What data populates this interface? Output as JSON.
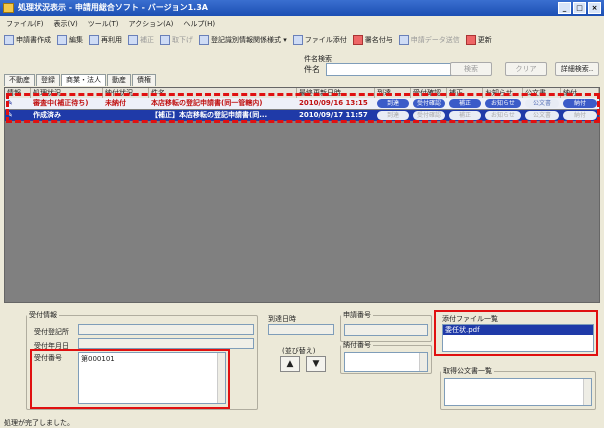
{
  "window": {
    "title": "処理状況表示 - 申請用総合ソフト - バージョン1.3A",
    "controls": [
      "_",
      "□",
      "×"
    ]
  },
  "menu": [
    "ファイル(F)",
    "表示(V)",
    "ツール(T)",
    "アクション(A)",
    "ヘルプ(H)"
  ],
  "toolbar": [
    "申請書作成",
    "編集",
    "再利用",
    "補正",
    "取下げ",
    "登記識別情報関係様式 ▾",
    "ファイル添付",
    "署名付与",
    "申請データ送信",
    "更新"
  ],
  "search": {
    "group_label": "件名検索",
    "field_label": "件名",
    "value": "",
    "buttons": [
      "検索",
      "クリア",
      "詳細検索.."
    ]
  },
  "tabs": [
    "不動産",
    "登録",
    "商業・法人",
    "動産",
    "債権"
  ],
  "active_tab": "商業・法人",
  "table": {
    "headers": [
      "情報",
      "処理状況",
      "納付状況",
      "件名",
      "最終更新日時",
      "到達",
      "受付確認",
      "補正",
      "お知らせ",
      "公文書",
      "納付"
    ],
    "rows": [
      {
        "status": "審査中(補正待ち)",
        "payment": "未納付",
        "subject": "本店移転の登記申請書(同一管轄内)",
        "updated": "2010/09/16 13:15",
        "buttons": [
          "到達",
          "受付確認",
          "補正",
          "お知らせ",
          "公文書",
          "納付"
        ],
        "active": [
          true,
          true,
          true,
          true,
          false,
          true
        ]
      },
      {
        "status": "作成済み",
        "payment": "",
        "subject": "【補正】本店移転の登記申請書(同...",
        "updated": "2010/09/17 11:57",
        "buttons": [
          "到達",
          "受付確認",
          "補正",
          "お知らせ",
          "公文書",
          "納付"
        ],
        "active": [
          false,
          false,
          false,
          false,
          false,
          false
        ]
      }
    ]
  },
  "reception": {
    "group_label": "受付情報",
    "office_label": "受付登記所",
    "date_label": "受付年月日",
    "number_label": "受付番号",
    "number_value": "第000101",
    "arrival_label": "到達日時",
    "sort_label": "(並び替え)",
    "apply_label": "申請番号",
    "payment_label": "納付番号"
  },
  "attachments": {
    "label": "添付ファイル一覧",
    "items": [
      "委任状.pdf"
    ]
  },
  "official": {
    "label": "取得公文書一覧"
  },
  "status": "処理が完了しました。"
}
